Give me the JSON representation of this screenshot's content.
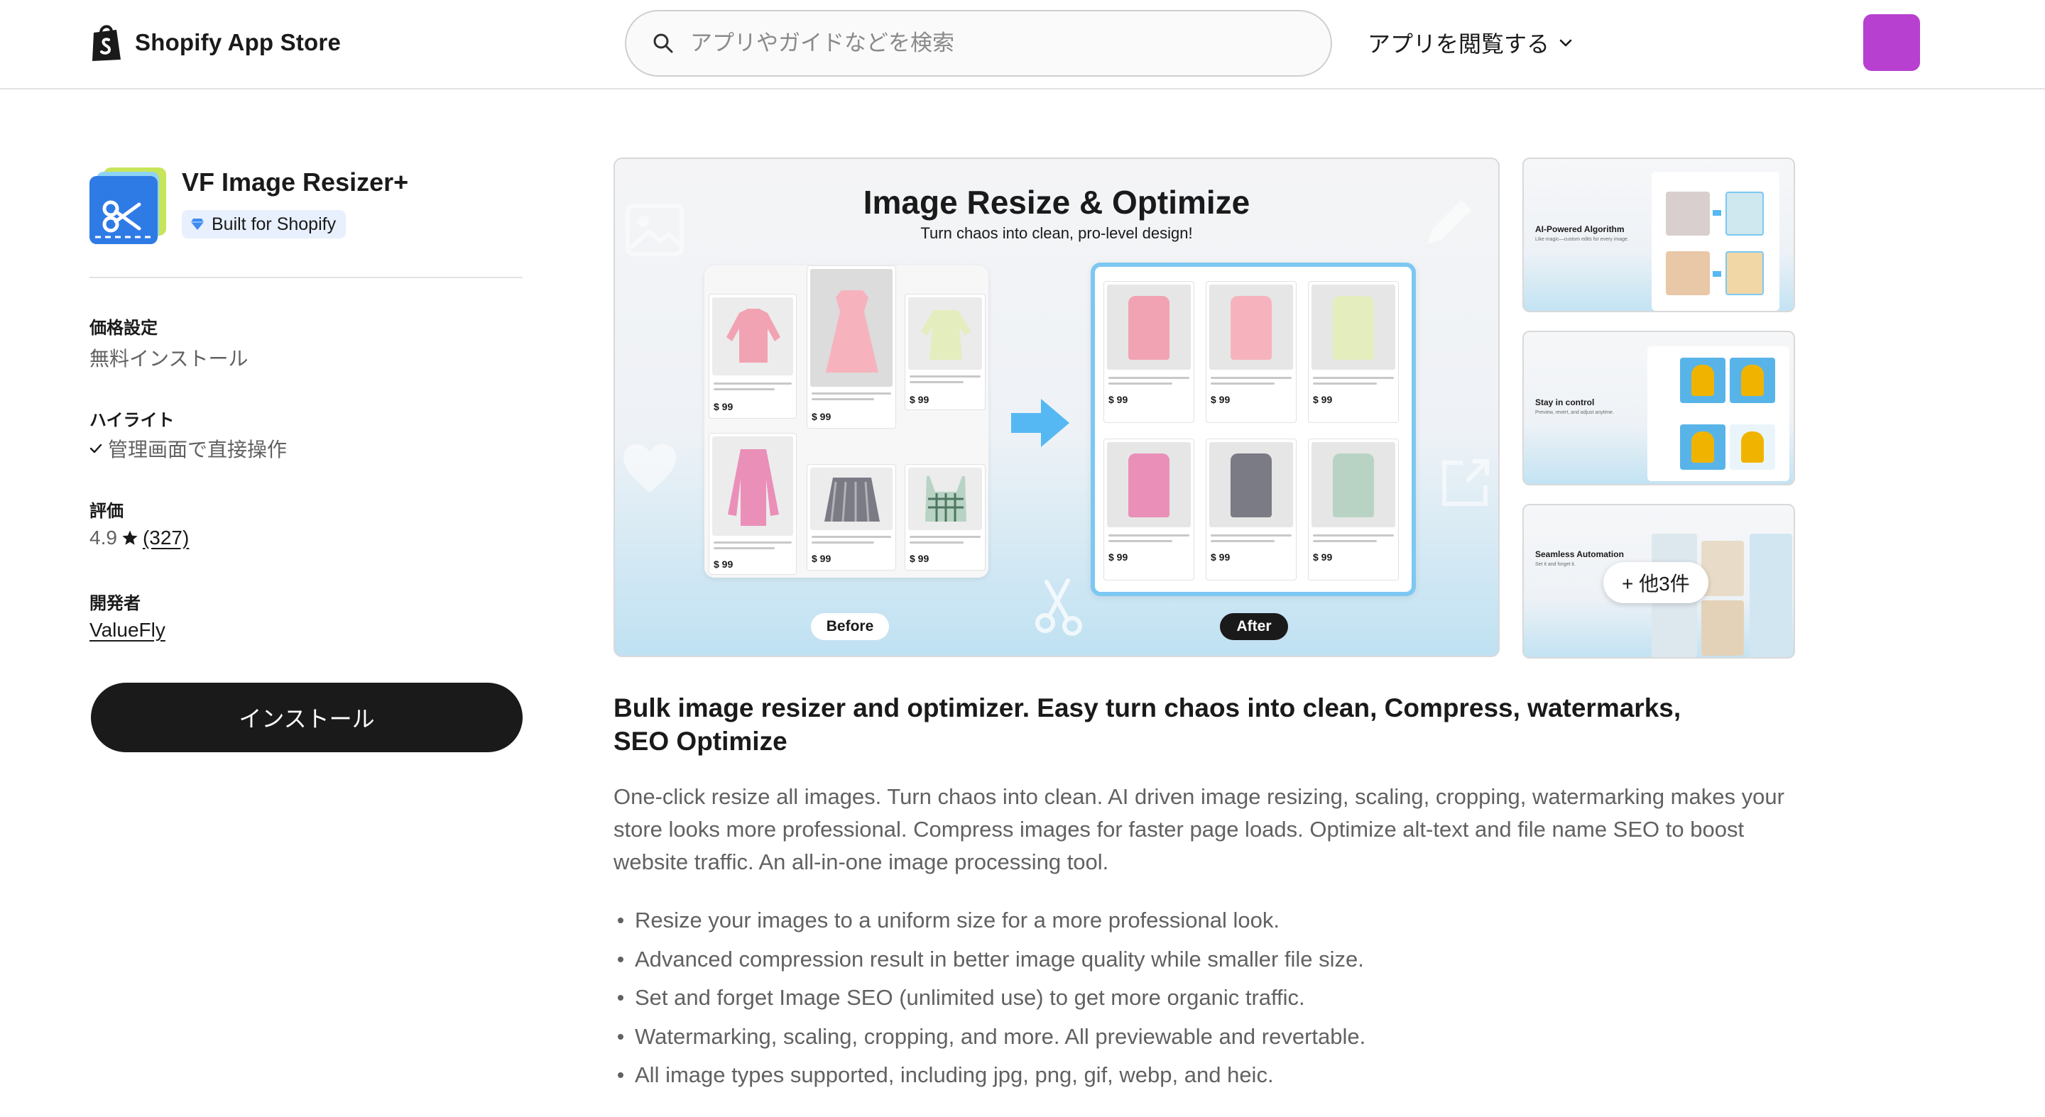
{
  "header": {
    "logo_text": "Shopify App Store",
    "search_placeholder": "アプリやガイドなどを検索",
    "browse_label": "アプリを閲覧する",
    "avatar_color": "#b740d0"
  },
  "app": {
    "name": "VF Image Resizer+",
    "badge": "Built for Shopify",
    "pricing_label": "価格設定",
    "pricing_value": "無料インストール",
    "highlight_label": "ハイライト",
    "highlight_value": "管理画面で直接操作",
    "rating_label": "評価",
    "rating_value": "4.9",
    "rating_count": "(327)",
    "developer_label": "開発者",
    "developer_name": "ValueFly",
    "install_label": "インストール"
  },
  "gallery": {
    "main": {
      "title": "Image Resize & Optimize",
      "subtitle": "Turn chaos into clean, pro-level design!",
      "before_label": "Before",
      "after_label": "After",
      "price": "$ 99"
    },
    "thumbs": [
      {
        "title": "AI-Powered Algorithm",
        "subtitle": "Like magic—custom edits for every image."
      },
      {
        "title": "Stay in control",
        "subtitle": "Preview, revert, and adjust anytime."
      },
      {
        "title": "Seamless Automation",
        "subtitle": "Set it and forget it."
      }
    ],
    "more_label": "+ 他3件"
  },
  "description": {
    "headline": "Bulk image resizer and optimizer. Easy turn chaos into clean, Compress, watermarks, SEO Optimize",
    "body": "One-click resize all images. Turn chaos into clean. AI driven image resizing, scaling, cropping, watermarking makes your store looks more professional. Compress images for faster page loads. Optimize alt-text and file name SEO to boost website traffic. An all-in-one image processing tool.",
    "features": [
      "Resize your images to a uniform size for a more professional look.",
      "Advanced compression result in better image quality while smaller file size.",
      "Set and forget Image SEO (unlimited use) to get more organic traffic.",
      "Watermarking, scaling, cropping, and more. All previewable and revertable.",
      "All image types supported, including jpg, png, gif, webp, and heic."
    ]
  },
  "colors": {
    "accent_blue": "#7cc8f2",
    "install_bg": "#1a1a1a",
    "badge_bg": "#e8f0fd"
  }
}
